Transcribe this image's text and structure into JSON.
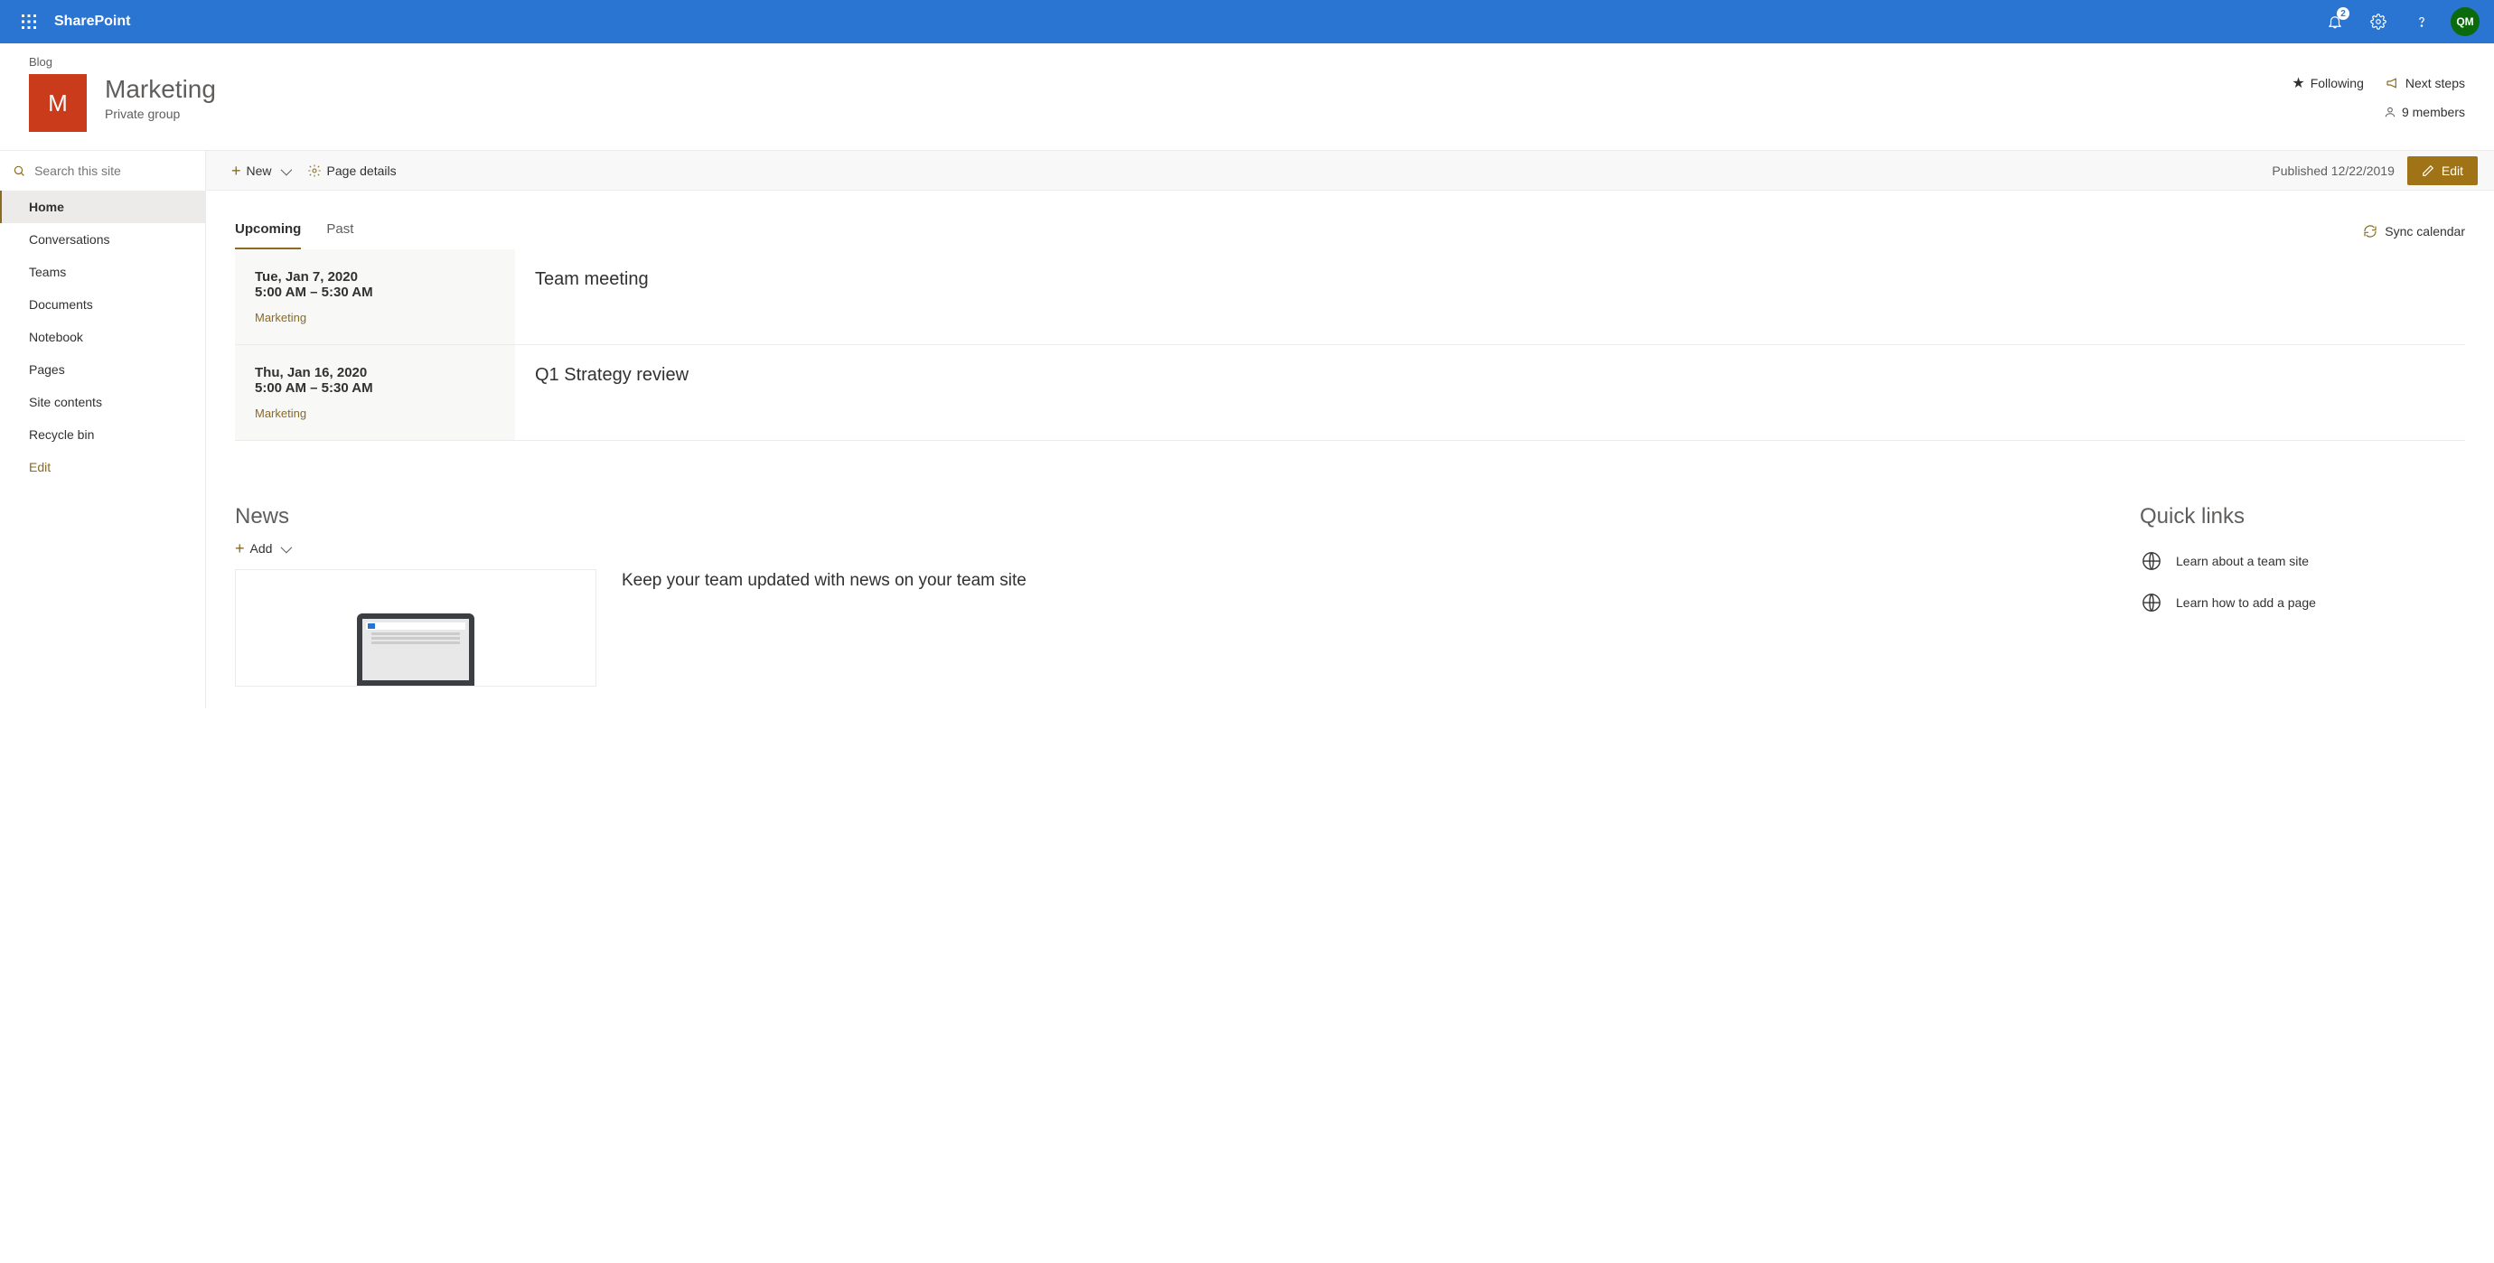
{
  "suite": {
    "app_name": "SharePoint",
    "notification_count": "2",
    "avatar_initials": "QM"
  },
  "site": {
    "blog_label": "Blog",
    "logo_letter": "M",
    "title": "Marketing",
    "subtitle": "Private group",
    "following_label": "Following",
    "next_steps_label": "Next steps",
    "members_label": "9 members"
  },
  "search": {
    "placeholder": "Search this site"
  },
  "commands": {
    "new_label": "New",
    "page_details_label": "Page details",
    "published_label": "Published 12/22/2019",
    "edit_label": "Edit"
  },
  "nav": {
    "items": [
      "Home",
      "Conversations",
      "Teams",
      "Documents",
      "Notebook",
      "Pages",
      "Site contents",
      "Recycle bin"
    ],
    "edit_label": "Edit"
  },
  "events": {
    "tab_upcoming": "Upcoming",
    "tab_past": "Past",
    "sync_label": "Sync calendar",
    "list": [
      {
        "date": "Tue, Jan 7, 2020",
        "time": "5:00 AM – 5:30 AM",
        "category": "Marketing",
        "title": "Team meeting"
      },
      {
        "date": "Thu, Jan 16, 2020",
        "time": "5:00 AM – 5:30 AM",
        "category": "Marketing",
        "title": "Q1 Strategy review"
      }
    ]
  },
  "news": {
    "heading": "News",
    "add_label": "Add",
    "teaser": "Keep your team updated with news on your team site"
  },
  "quicklinks": {
    "heading": "Quick links",
    "items": [
      {
        "label": "Learn about a team site"
      },
      {
        "label": "Learn how to add a page"
      }
    ]
  }
}
